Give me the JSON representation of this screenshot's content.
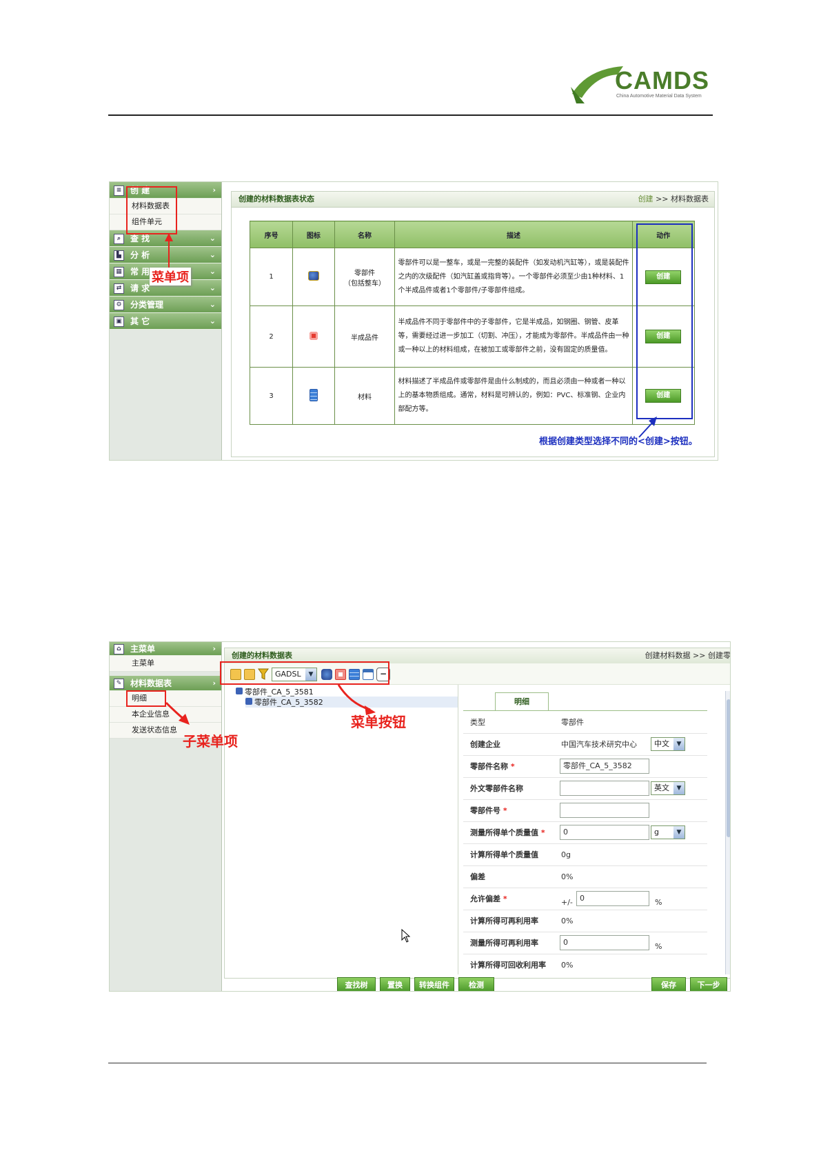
{
  "header": {
    "logo_main": "CAMDS",
    "logo_sub": "China Automotive Material Data System"
  },
  "shot1": {
    "menu": {
      "create": {
        "label": "创 建",
        "items": [
          "材料数据表",
          "组件单元"
        ]
      },
      "groups": [
        "查 找",
        "分 析",
        "常 用",
        "请 求",
        "分类管理",
        "其 它"
      ]
    },
    "panel_title": "创建的材料数据表状态",
    "crumb_link": "创建",
    "crumb_sep": ">>",
    "crumb_current": "材料数据表",
    "table": {
      "headers": [
        "序号",
        "图标",
        "名称",
        "描述",
        "动作"
      ],
      "rows": [
        {
          "no": "1",
          "name_line1": "零部件",
          "name_line2": "（包括整车）",
          "desc": "零部件可以是一整车，或是一完整的装配件（如发动机汽缸等），或是装配件之内的次级配件（如汽缸盖或指背等）。一个零部件必须至少由1种材料、1个半成品件或者1个零部件/子零部件组成。",
          "action": "创建"
        },
        {
          "no": "2",
          "name_line1": "半成品件",
          "name_line2": "",
          "desc": "半成品件不同于零部件中的子零部件，它是半成品，如钢圈、钢管、皮革等，需要经过进一步加工（切割、冲压），才能成为零部件。半成品件由一种或一种以上的材料组成，在被加工或零部件之前，没有固定的质量值。",
          "action": "创建"
        },
        {
          "no": "3",
          "name_line1": "材料",
          "name_line2": "",
          "desc": "材料描述了半成品件或零部件是由什么制成的，而且必须由一种或者一种以上的基本物质组成。通常，材料是可辨认的，例如：PVC、标准钢、企业内部配方等。",
          "action": "创建"
        }
      ]
    },
    "annotation_menu": "菜单项",
    "annotation_button": "根据创建类型选择不同的<创建>按钮。"
  },
  "shot2": {
    "menu": {
      "main": {
        "label": "主菜单",
        "items": [
          "主菜单"
        ]
      },
      "datasheet": {
        "label": "材料数据表",
        "items": [
          "明细",
          "本企业信息",
          "发送状态信息"
        ]
      }
    },
    "panel_title": "创建的材料数据表",
    "crumb": "创建材料数据 >> 创建零",
    "toolbar_select": "GADSL",
    "tree": [
      "零部件_CA_5_3581",
      "零部件_CA_5_3582"
    ],
    "tab_label": "明细",
    "form": [
      {
        "label": "类型",
        "value": "零部件"
      },
      {
        "label": "创建企业",
        "value": "中国汽车技术研究中心",
        "select": "中文"
      },
      {
        "label": "零部件名称",
        "required": "*",
        "input": "零部件_CA_5_3582"
      },
      {
        "label": "外文零部件名称",
        "input": "",
        "select": "英文"
      },
      {
        "label": "零部件号",
        "required": "*",
        "input": ""
      },
      {
        "label": "测量所得单个质量值",
        "required": "*",
        "input": "0",
        "select": "g"
      },
      {
        "label": "计算所得单个质量值",
        "value": "0g"
      },
      {
        "label": "偏差",
        "value": "0%"
      },
      {
        "label": "允许偏差",
        "required": "*",
        "prefix": "+/-",
        "input": "0",
        "unit": "%"
      },
      {
        "label": "计算所得可再利用率",
        "value": "0%"
      },
      {
        "label": "测量所得可再利用率",
        "input": "0",
        "unit": "%"
      },
      {
        "label": "计算所得可回收利用率",
        "value": "0%"
      }
    ],
    "bottom_buttons": [
      "查找树",
      "置换",
      "转换组件",
      "检测"
    ],
    "right_buttons": [
      "保存",
      "下一步"
    ],
    "annotation_toolbar": "菜单按钮",
    "annotation_submenu": "子菜单项"
  }
}
